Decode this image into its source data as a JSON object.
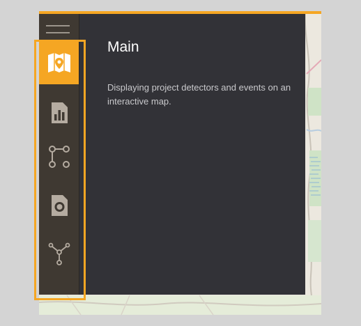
{
  "colors": {
    "accent": "#f5a623",
    "rail_background": "#3f3932",
    "panel_background": "#323237",
    "map_background": "#ece8df",
    "icon_color": "#b5aca1"
  },
  "sidebar": {
    "menu_icon": "hamburger-menu-icon",
    "items": [
      {
        "icon": "map-icon",
        "active": true
      },
      {
        "icon": "bar-chart-icon",
        "active": false
      },
      {
        "icon": "nodes-icon",
        "active": false
      },
      {
        "icon": "detector-icon",
        "active": false
      },
      {
        "icon": "network-icon",
        "active": false
      }
    ]
  },
  "panel": {
    "title": "Main",
    "description": "Displaying project detectors and events on an interactive map."
  }
}
